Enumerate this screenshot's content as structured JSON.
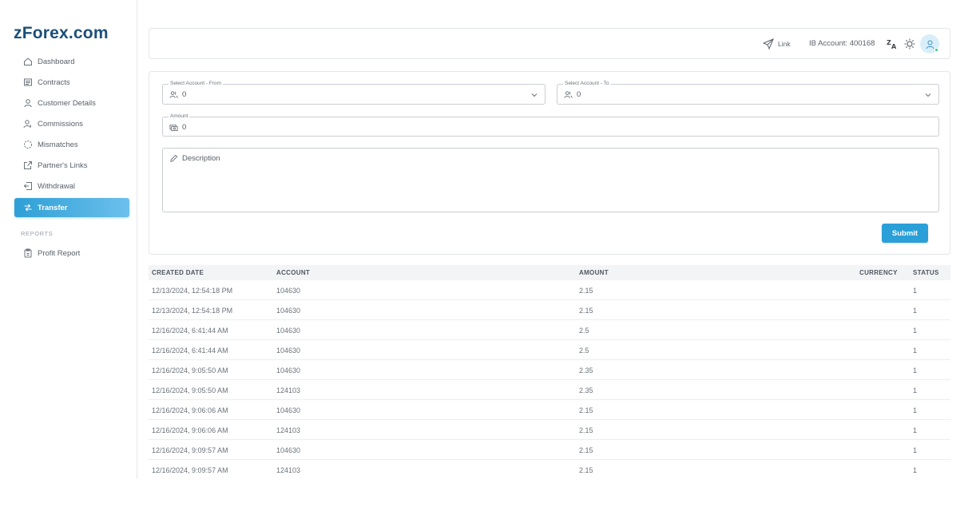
{
  "app": {
    "logo": "zForex.com"
  },
  "sidebar": {
    "items": [
      {
        "label": "Dashboard",
        "icon": "home-icon"
      },
      {
        "label": "Contracts",
        "icon": "contracts-icon"
      },
      {
        "label": "Customer Details",
        "icon": "user-icon"
      },
      {
        "label": "Commissions",
        "icon": "commission-user-icon"
      },
      {
        "label": "Mismatches",
        "icon": "loading-circle-icon"
      },
      {
        "label": "Partner's Links",
        "icon": "external-link-icon"
      },
      {
        "label": "Withdrawal",
        "icon": "withdrawal-icon"
      },
      {
        "label": "Transfer",
        "icon": "transfer-icon",
        "active": true
      }
    ],
    "section_label": "REPORTS",
    "report_items": [
      {
        "label": "Profit Report",
        "icon": "clipboard-icon"
      }
    ]
  },
  "header": {
    "link_label": "Link",
    "ib_account": "IB Account: 400168",
    "icons": [
      "send-icon",
      "translate-icon",
      "sun-icon",
      "avatar-icon"
    ]
  },
  "form": {
    "from": {
      "label": "Select Account - From",
      "value": "0"
    },
    "to": {
      "label": "Select Account - To",
      "value": "0"
    },
    "amount": {
      "label": "Amount",
      "value": "0"
    },
    "description": {
      "placeholder": "Description"
    },
    "submit_label": "Submit"
  },
  "table": {
    "columns": [
      "CREATED DATE",
      "ACCOUNT",
      "AMOUNT",
      "CURRENCY",
      "STATUS"
    ],
    "rows": [
      {
        "date": "12/13/2024, 12:54:18 PM",
        "account": "104630",
        "amount": "2.15",
        "currency": "",
        "status": "1"
      },
      {
        "date": "12/13/2024, 12:54:18 PM",
        "account": "104630",
        "amount": "2.15",
        "currency": "",
        "status": "1"
      },
      {
        "date": "12/16/2024, 6:41:44 AM",
        "account": "104630",
        "amount": "2.5",
        "currency": "",
        "status": "1"
      },
      {
        "date": "12/16/2024, 6:41:44 AM",
        "account": "104630",
        "amount": "2.5",
        "currency": "",
        "status": "1"
      },
      {
        "date": "12/16/2024, 9:05:50 AM",
        "account": "104630",
        "amount": "2.35",
        "currency": "",
        "status": "1"
      },
      {
        "date": "12/16/2024, 9:05:50 AM",
        "account": "124103",
        "amount": "2.35",
        "currency": "",
        "status": "1"
      },
      {
        "date": "12/16/2024, 9:06:06 AM",
        "account": "104630",
        "amount": "2.15",
        "currency": "",
        "status": "1"
      },
      {
        "date": "12/16/2024, 9:06:06 AM",
        "account": "124103",
        "amount": "2.15",
        "currency": "",
        "status": "1"
      },
      {
        "date": "12/16/2024, 9:09:57 AM",
        "account": "104630",
        "amount": "2.15",
        "currency": "",
        "status": "1"
      },
      {
        "date": "12/16/2024, 9:09:57 AM",
        "account": "124103",
        "amount": "2.15",
        "currency": "",
        "status": "1"
      }
    ]
  },
  "colors": {
    "brand": "#1c4f78",
    "accent": "#2a9fd8",
    "online": "#2ecc71"
  }
}
